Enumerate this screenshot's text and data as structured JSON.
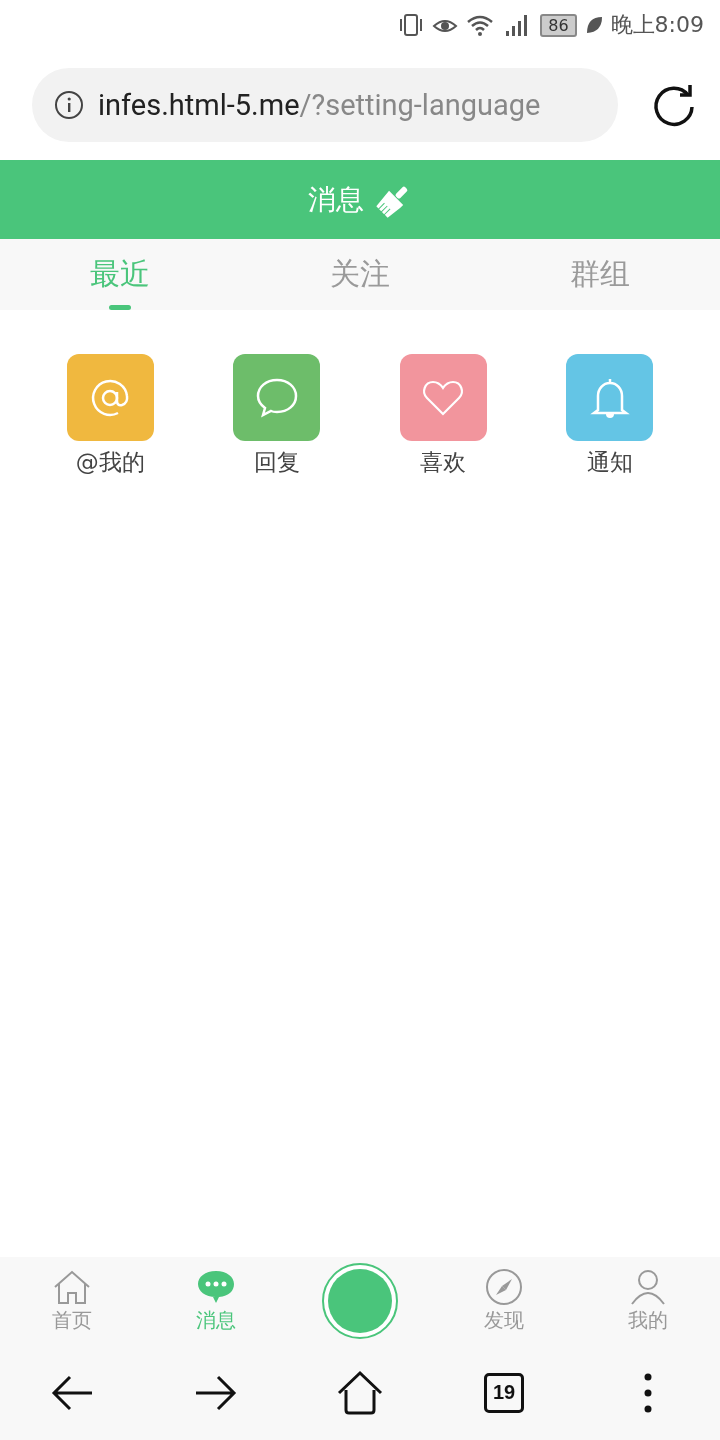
{
  "status_bar": {
    "battery": "86",
    "time": "晚上8:09"
  },
  "address_bar": {
    "host": "infes.html-5.me",
    "path": "/?setting-language"
  },
  "header": {
    "title": "消息"
  },
  "tabs": [
    {
      "label": "最近",
      "selected": true
    },
    {
      "label": "关注",
      "selected": false
    },
    {
      "label": "群组",
      "selected": false
    }
  ],
  "shortcuts": [
    {
      "label": "@我的",
      "kind": "at",
      "color": "#f0b83f"
    },
    {
      "label": "回复",
      "kind": "chat",
      "color": "#6dbd6a"
    },
    {
      "label": "喜欢",
      "kind": "heart",
      "color": "#f2959d"
    },
    {
      "label": "通知",
      "kind": "bell",
      "color": "#64c5e5"
    }
  ],
  "bottom_nav": [
    {
      "label": "首页",
      "kind": "home",
      "selected": false
    },
    {
      "label": "消息",
      "kind": "message",
      "selected": true
    },
    {
      "kind": "center",
      "selected": false
    },
    {
      "label": "发现",
      "kind": "compass",
      "selected": false
    },
    {
      "label": "我的",
      "kind": "user",
      "selected": false
    }
  ],
  "browser_toolbar": {
    "tab_count": "19"
  }
}
